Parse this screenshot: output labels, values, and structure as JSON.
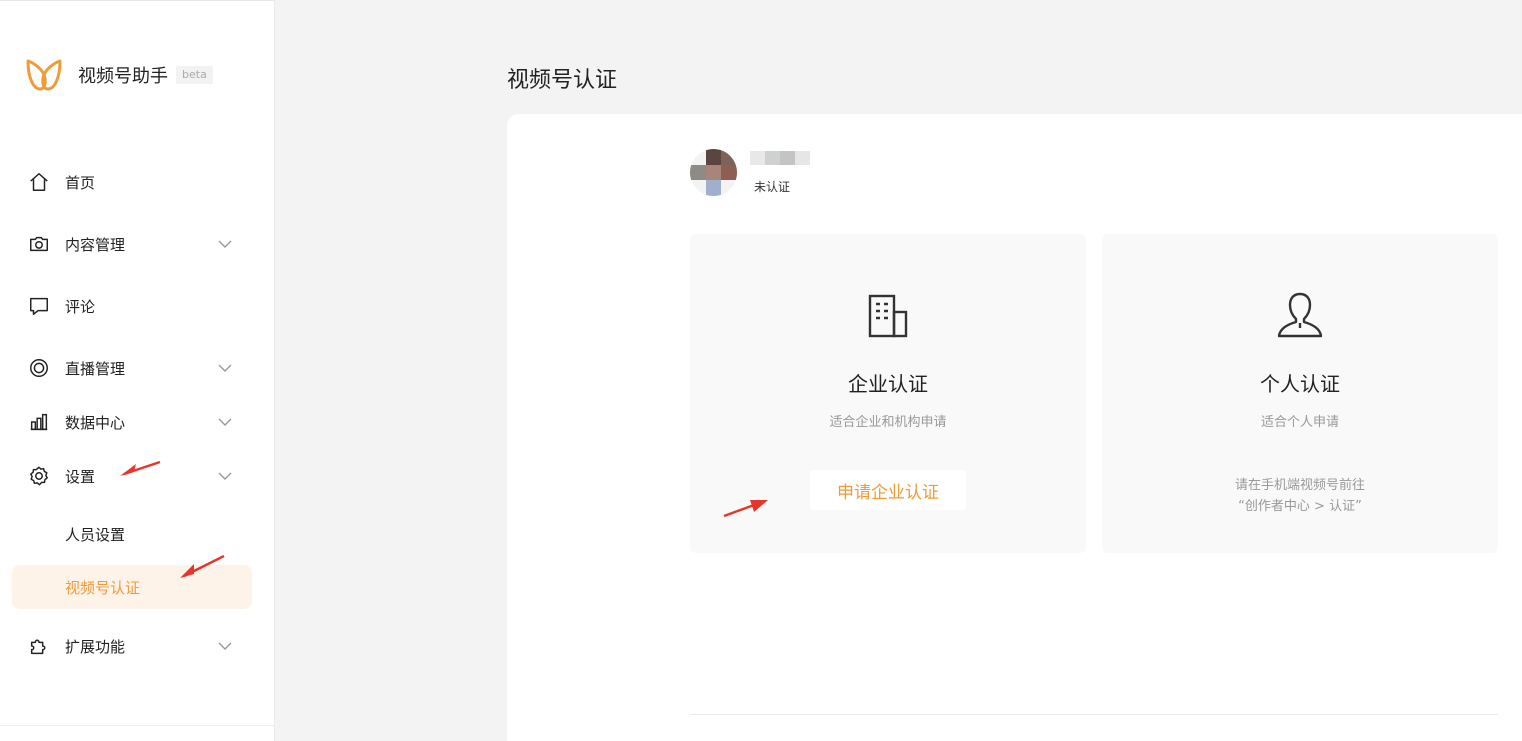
{
  "app": {
    "name": "视频号助手",
    "badge": "beta",
    "brand_color": "#f09b3a"
  },
  "sidebar": {
    "items": [
      {
        "label": "首页",
        "icon": "home-icon",
        "has_chevron": false
      },
      {
        "label": "内容管理",
        "icon": "camera-icon",
        "has_chevron": true
      },
      {
        "label": "评论",
        "icon": "comment-icon",
        "has_chevron": false
      },
      {
        "label": "直播管理",
        "icon": "live-icon",
        "has_chevron": true
      },
      {
        "label": "数据中心",
        "icon": "chart-icon",
        "has_chevron": true
      },
      {
        "label": "设置",
        "icon": "gear-icon",
        "has_chevron": true,
        "expanded": true
      },
      {
        "label": "扩展功能",
        "icon": "puzzle-icon",
        "has_chevron": true
      }
    ],
    "sub_items": [
      {
        "label": "人员设置",
        "active": false
      },
      {
        "label": "视频号认证",
        "active": true
      }
    ]
  },
  "page": {
    "title": "视频号认证"
  },
  "account": {
    "status": "未认证"
  },
  "cards": {
    "enterprise": {
      "title": "企业认证",
      "subtitle": "适合企业和机构申请",
      "button": "申请企业认证",
      "icon": "building-icon"
    },
    "personal": {
      "title": "个人认证",
      "subtitle": "适合个人申请",
      "hint_line1": "请在手机端视频号前往",
      "hint_line2": "“创作者中心 > 认证”",
      "icon": "person-icon"
    }
  },
  "annotation_color": "#e8352b"
}
